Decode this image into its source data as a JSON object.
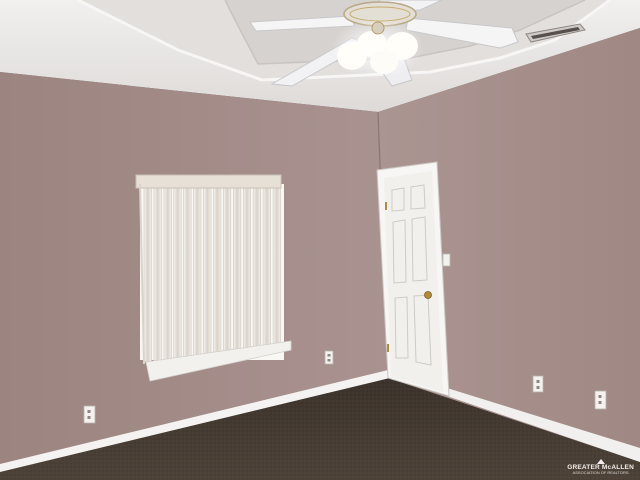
{
  "photo": {
    "subject": "empty bedroom",
    "colors": {
      "wall_left": "#a58e89",
      "wall_right": "#a88f8b",
      "ceiling": "#e8e6e4",
      "carpet": "#4a3f36",
      "trim": "#f4f3f1",
      "door": "#f1f0ed",
      "blinds": "#e9e4dc"
    }
  },
  "watermark": {
    "name": "GREATER McALLEN",
    "tagline": "ASSOCIATION OF REALTORS"
  }
}
